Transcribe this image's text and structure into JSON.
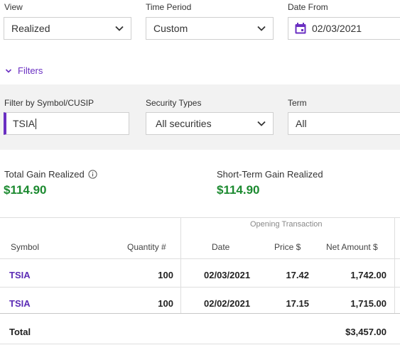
{
  "view": {
    "label": "View",
    "selected": "Realized"
  },
  "time_period": {
    "label": "Time Period",
    "selected": "Custom"
  },
  "date_from": {
    "label": "Date From",
    "value": "02/03/2021"
  },
  "filters_toggle": {
    "label": "Filters"
  },
  "filters": {
    "symbol": {
      "label": "Filter by Symbol/CUSIP",
      "value": "TSIA"
    },
    "security_types": {
      "label": "Security Types",
      "selected": "All securities"
    },
    "term": {
      "label": "Term",
      "selected": "All"
    }
  },
  "summary": {
    "total_gain": {
      "label": "Total Gain Realized",
      "value": "$114.90"
    },
    "short_term_gain": {
      "label": "Short-Term Gain Realized",
      "value": "$114.90"
    }
  },
  "table": {
    "group_header": "Opening Transaction",
    "columns": {
      "symbol": "Symbol",
      "quantity": "Quantity #",
      "date": "Date",
      "price": "Price $",
      "net_amount": "Net Amount $"
    },
    "rows": [
      {
        "symbol": "TSIA",
        "quantity": "100",
        "date": "02/03/2021",
        "price": "17.42",
        "net_amount": "1,742.00"
      },
      {
        "symbol": "TSIA",
        "quantity": "100",
        "date": "02/02/2021",
        "price": "17.15",
        "net_amount": "1,715.00"
      }
    ],
    "total": {
      "label": "Total",
      "net_amount": "$3,457.00"
    }
  },
  "colors": {
    "accent": "#6a2fc2",
    "gain": "#1c8a30",
    "panel_bg": "#f2f2f2"
  }
}
